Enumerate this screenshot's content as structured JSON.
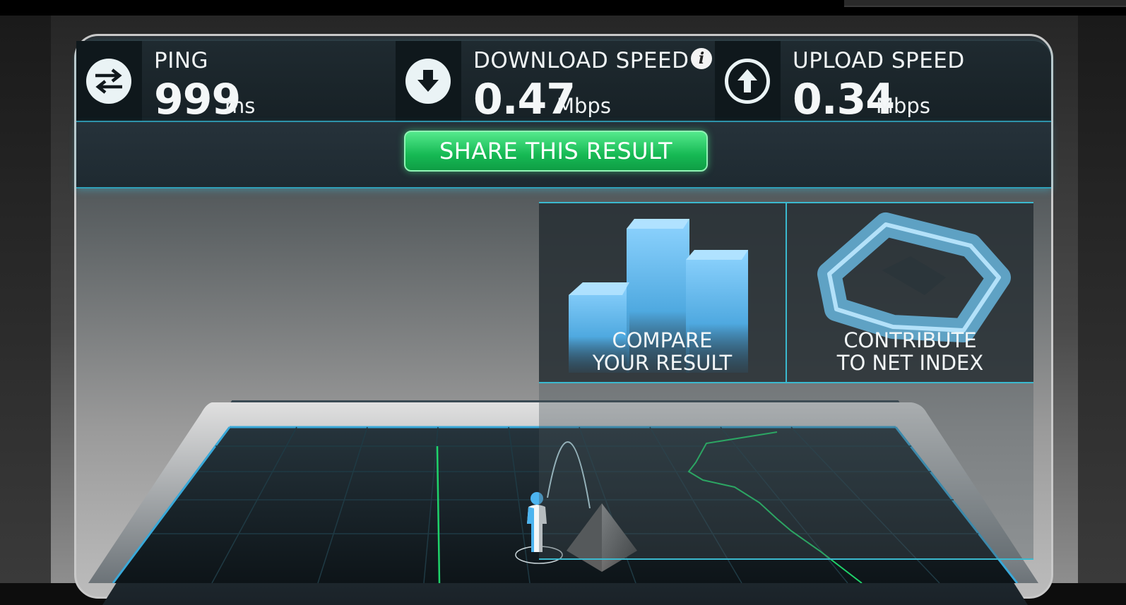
{
  "stats": {
    "ping": {
      "label": "PING",
      "value": "999",
      "unit": "ms",
      "icon": "swap-arrows-icon"
    },
    "download": {
      "label": "DOWNLOAD SPEED",
      "value": "0.47",
      "unit": "Mbps",
      "icon": "download-arrow-icon",
      "info_icon": "info-icon"
    },
    "upload": {
      "label": "UPLOAD SPEED",
      "value": "0.34",
      "unit": "Mbps",
      "icon": "upload-arrow-icon"
    }
  },
  "share": {
    "label": "SHARE THIS RESULT"
  },
  "panel": {
    "compare": {
      "line1": "COMPARE",
      "line2": "YOUR RESULT",
      "icon": "bar-chart-icon"
    },
    "contribute": {
      "line1": "CONTRIBUTE",
      "line2": "TO NET INDEX",
      "icon": "loop-icon"
    }
  },
  "colors": {
    "accent": "#3bb9cf",
    "share_green": "#16b954",
    "graph_green": "#1fd36a",
    "tile_blue": "#56b6f0"
  }
}
